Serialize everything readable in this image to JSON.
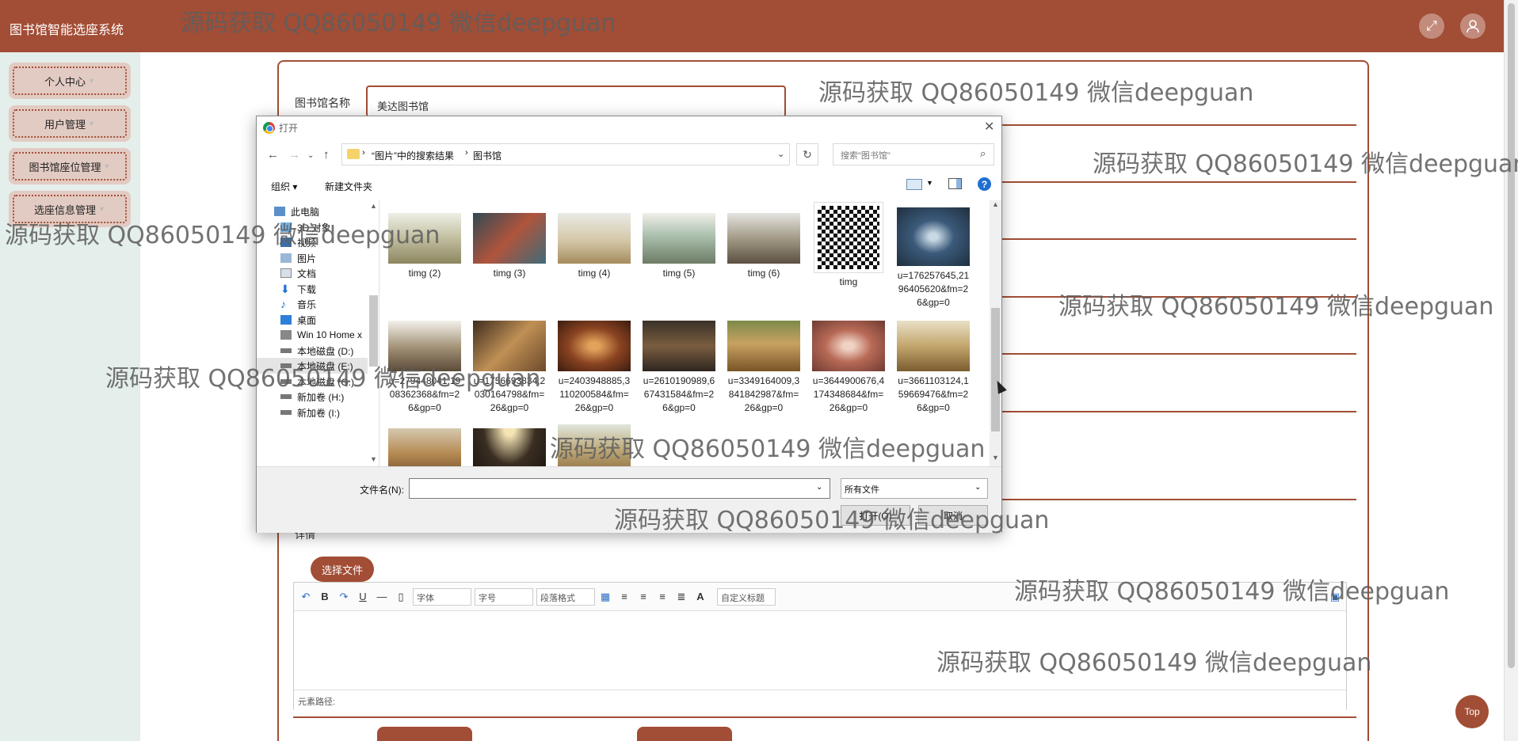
{
  "app": {
    "title": "图书馆智能选座系统"
  },
  "header": {
    "fullscreen_icon": "fullscreen-icon",
    "user_icon": "user-icon"
  },
  "sidebar": {
    "items": [
      {
        "label": "个人中心"
      },
      {
        "label": "用户管理"
      },
      {
        "label": "图书馆座位管理"
      },
      {
        "label": "选座信息管理"
      }
    ]
  },
  "form": {
    "library_name_label": "图书馆名称",
    "library_name_value": "美达图书馆",
    "detail_label": "详情",
    "choose_file_label": "选择文件"
  },
  "editor": {
    "font_select": "字体",
    "size_select": "字号",
    "para_select": "段落格式",
    "custom_title_select": "自定义标题",
    "path_label": "元素路径:"
  },
  "top_button": "Top",
  "dialog": {
    "title": "打开",
    "breadcrumb": [
      "“图片”中的搜索结果",
      "图书馆"
    ],
    "search_placeholder": "搜索\"图书馆\"",
    "organize_label": "组织 ▾",
    "new_folder_label": "新建文件夹",
    "tree": [
      "此电脑",
      "3D 对象",
      "视频",
      "图片",
      "文档",
      "下载",
      "音乐",
      "桌面",
      "Win 10 Home x",
      "本地磁盘 (D:)",
      "本地磁盘 (E:)",
      "本地磁盘 (G:)",
      "新加卷 (H:)",
      "新加卷 (I:)"
    ],
    "files_row1": [
      "timg (2)",
      "timg (3)",
      "timg (4)",
      "timg (5)",
      "timg (6)",
      "timg",
      "u=176257645,2196405620&fm=26&gp=0"
    ],
    "files_row2": [
      "u=279448041,1908362368&fm=26&gp=0",
      "u=1756693834,2030164798&fm=26&gp=0",
      "u=2403948885,3110200584&fm=26&gp=0",
      "u=2610190989,667431584&fm=26&gp=0",
      "u=3349164009,3841842987&fm=26&gp=0",
      "u=3644900676,4174348684&fm=26&gp=0",
      "u=3661103124,159669476&fm=26&gp=0"
    ],
    "filename_label": "文件名(N):",
    "filename_value": "",
    "filetype_value": "所有文件",
    "open_label": "打开(O)",
    "cancel_label": "取消"
  },
  "watermark": "源码获取 QQ86050149 微信deepguan",
  "colors": {
    "brand": "#a24d35",
    "sidebar_bg": "#e4eeea"
  }
}
